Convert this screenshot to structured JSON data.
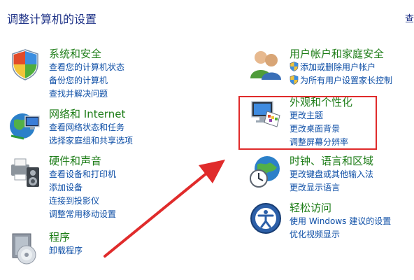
{
  "page": {
    "title": "调整计算机的设置",
    "edge_label": "查"
  },
  "categories": {
    "system": {
      "title": "系统和安全",
      "links": [
        "查看您的计算机状态",
        "备份您的计算机",
        "查找并解决问题"
      ]
    },
    "network": {
      "title": "网络和 Internet",
      "links": [
        "查看网络状态和任务",
        "选择家庭组和共享选项"
      ]
    },
    "hardware": {
      "title": "硬件和声音",
      "links": [
        "查看设备和打印机",
        "添加设备",
        "连接到投影仪",
        "调整常用移动设置"
      ]
    },
    "programs": {
      "title": "程序",
      "links": [
        "卸载程序"
      ]
    },
    "users": {
      "title": "用户帐户和家庭安全",
      "links": [
        "添加或删除用户帐户",
        "为所有用户设置家长控制"
      ]
    },
    "appearance": {
      "title": "外观和个性化",
      "links": [
        "更改主题",
        "更改桌面背景",
        "调整屏幕分辨率"
      ]
    },
    "clock": {
      "title": "时钟、语言和区域",
      "links": [
        "更改键盘或其他输入法",
        "更改显示语言"
      ]
    },
    "ease": {
      "title": "轻松访问",
      "links": [
        "使用 Windows 建议的设置",
        "优化视频显示"
      ]
    }
  },
  "colors": {
    "title": "#1e3287",
    "category": "#1e7d18",
    "link": "#0d4ea6",
    "annotation": "#e02b2b"
  }
}
